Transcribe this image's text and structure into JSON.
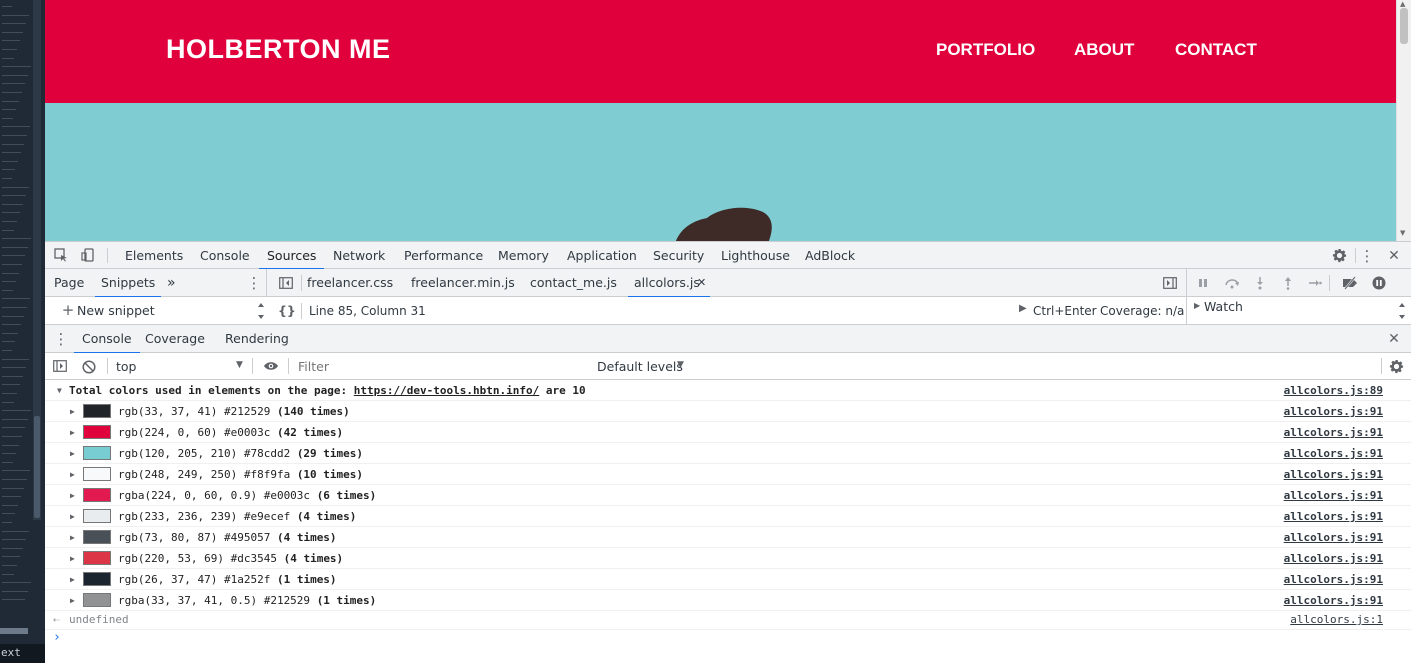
{
  "site": {
    "brand": "HOLBERTON ME",
    "nav": [
      "PORTFOLIO",
      "ABOUT",
      "CONTACT"
    ],
    "colors": {
      "nav": "#e0003c",
      "hero": "#7fcdd2",
      "avatar": "#3e2a27"
    }
  },
  "left_strip": {
    "label": "ext"
  },
  "devtools": {
    "main_tabs": [
      "Elements",
      "Console",
      "Sources",
      "Network",
      "Performance",
      "Memory",
      "Application",
      "Security",
      "Lighthouse",
      "AdBlock"
    ],
    "active_main_tab": "Sources",
    "navigator_tabs": [
      "Page",
      "Snippets"
    ],
    "navigator_more": "»",
    "new_snippet": "New snippet",
    "file_tabs": [
      "freelancer.css",
      "freelancer.min.js",
      "contact_me.js",
      "allcolors.js"
    ],
    "active_file": "allcolors.js",
    "close_file": "✕",
    "pretty_print": "{}",
    "cursor_position": "Line 85, Column 31",
    "run_hint": "Ctrl+Enter",
    "coverage": "Coverage: n/a",
    "watch_label": "Watch",
    "drawer_tabs": [
      "Console",
      "Coverage",
      "Rendering"
    ],
    "context": "top",
    "filter_placeholder": "Filter",
    "levels": "Default levels"
  },
  "console": {
    "header": {
      "prefix": "Total colors used in elements on the page:",
      "url": "https://dev-tools.hbtn.info/",
      "suffix": "are 10",
      "source": "allcolors.js:89"
    },
    "entries": [
      {
        "text": "rgb(33, 37, 41) #212529 ",
        "count": "(140 times)",
        "swatch": "#212529",
        "source": "allcolors.js:91"
      },
      {
        "text": "rgb(224, 0, 60) #e0003c ",
        "count": "(42 times)",
        "swatch": "#e0003c",
        "source": "allcolors.js:91"
      },
      {
        "text": "rgb(120, 205, 210) #78cdd2 ",
        "count": "(29 times)",
        "swatch": "#78cdd2",
        "source": "allcolors.js:91"
      },
      {
        "text": "rgb(248, 249, 250) #f8f9fa ",
        "count": "(10 times)",
        "swatch": "#f8f9fa",
        "source": "allcolors.js:91"
      },
      {
        "text": "rgba(224, 0, 60, 0.9) #e0003c ",
        "count": "(6 times)",
        "swatch": "#e31a50",
        "source": "allcolors.js:91"
      },
      {
        "text": "rgb(233, 236, 239) #e9ecef ",
        "count": "(4 times)",
        "swatch": "#e9ecef",
        "source": "allcolors.js:91"
      },
      {
        "text": "rgb(73, 80, 87) #495057 ",
        "count": "(4 times)",
        "swatch": "#495057",
        "source": "allcolors.js:91"
      },
      {
        "text": "rgb(220, 53, 69) #dc3545 ",
        "count": "(4 times)",
        "swatch": "#dc3545",
        "source": "allcolors.js:91"
      },
      {
        "text": "rgb(26, 37, 47) #1a252f ",
        "count": "(1 times)",
        "swatch": "#1a252f",
        "source": "allcolors.js:91"
      },
      {
        "text": "rgba(33, 37, 41, 0.5) #212529 ",
        "count": "(1 times)",
        "swatch": "#909294",
        "source": "allcolors.js:91"
      }
    ],
    "result": {
      "text": "undefined",
      "source": "allcolors.js:1"
    },
    "prompt": "›"
  }
}
